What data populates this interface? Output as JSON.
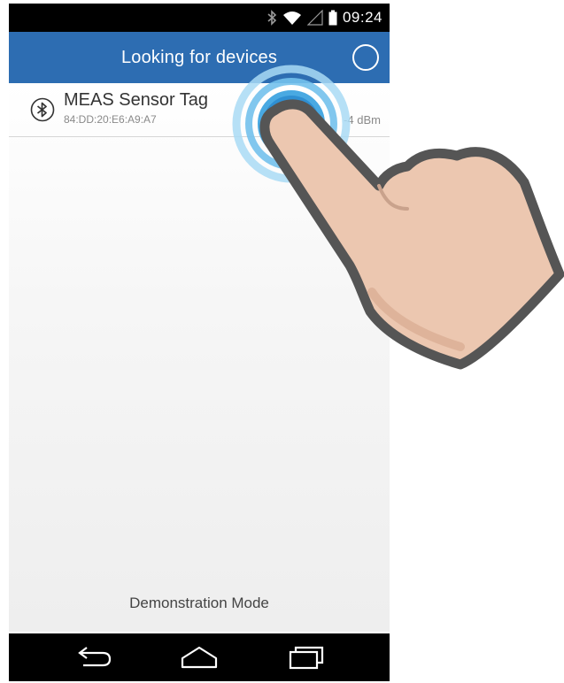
{
  "status_bar": {
    "time": "09:24",
    "icons": [
      "bluetooth-icon",
      "wifi-icon",
      "signal-icon",
      "battery-icon"
    ]
  },
  "action_bar": {
    "title": "Looking for devices",
    "scan_icon": "scan-progress-icon"
  },
  "device_list": [
    {
      "icon": "bluetooth-icon",
      "name": "MEAS Sensor Tag",
      "address": "84:DD:20:E6:A9:A7",
      "rssi": "-4 dBm"
    }
  ],
  "footer": {
    "mode_label": "Demonstration Mode"
  },
  "nav_bar": {
    "buttons": [
      "back-icon",
      "home-icon",
      "recent-apps-icon"
    ]
  },
  "overlay": {
    "gesture": "tap-hand-icon"
  },
  "colors": {
    "action_bar": "#2d6db2",
    "tap_ring": "#5ab4e6",
    "hand_fill": "#ecc7b0",
    "hand_outline": "#555555"
  }
}
